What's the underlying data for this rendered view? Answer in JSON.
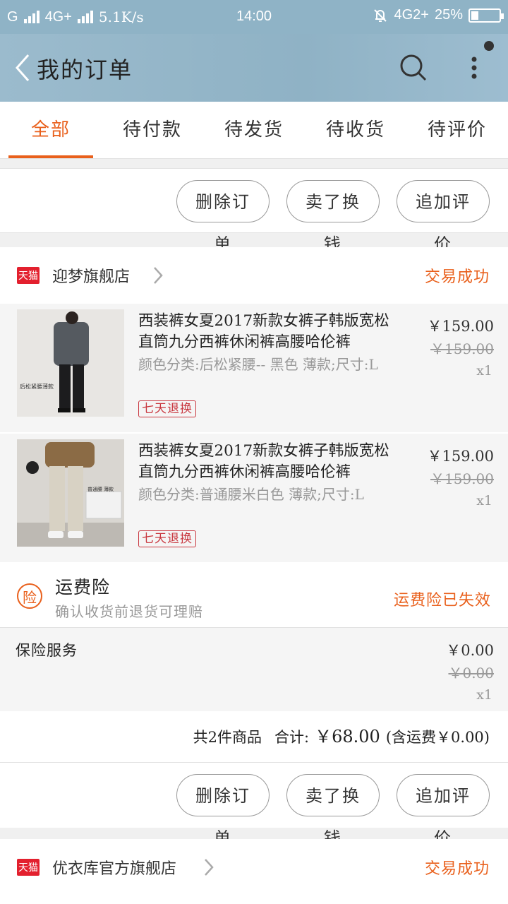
{
  "status_bar": {
    "carrier1": "G",
    "carrier2": "4G+",
    "speed": "5.1K/s",
    "time": "14:00",
    "network": "4G2+",
    "battery": "25%"
  },
  "header": {
    "title": "我的订单",
    "icons": [
      "back-icon",
      "search-icon",
      "more-icon"
    ]
  },
  "tabs": [
    {
      "label": "全部",
      "active": true
    },
    {
      "label": "待付款"
    },
    {
      "label": "待发货"
    },
    {
      "label": "待收货"
    },
    {
      "label": "待评价"
    }
  ],
  "actions": {
    "delete": "删除订单",
    "sell": "卖了换钱",
    "review": "追加评价"
  },
  "orders": [
    {
      "shop_badge": "天猫",
      "shop_name": "迎梦旗舰店",
      "status": "交易成功",
      "items": [
        {
          "name": "西装裤女夏2017新款女裤子韩版宽松直筒九分西裤休闲裤高腰哈伦裤",
          "sku": "颜色分类:后松紧腰-- 黑色  薄款;尺寸:L",
          "badge": "七天退换",
          "price": "￥159.00",
          "original_price": "￥159.00",
          "qty": "x1",
          "thumb_caption": "后松紧腰薄款"
        },
        {
          "name": "西装裤女夏2017新款女裤子韩版宽松直筒九分西裤休闲裤高腰哈伦裤",
          "sku": "颜色分类:普通腰米白色 薄款;尺寸:L",
          "badge": "七天退换",
          "price": "￥159.00",
          "original_price": "￥159.00",
          "qty": "x1",
          "thumb_caption": "普通腰 薄款"
        }
      ],
      "insurance": {
        "icon": "险",
        "title": "运费险",
        "subtitle": "确认收货前退货可理赔",
        "status": "运费险已失效"
      },
      "service": {
        "label": "保险服务",
        "price": "￥0.00",
        "original_price": "￥0.00",
        "qty": "x1"
      },
      "summary": {
        "count": "共2件商品",
        "total_label": "合计:",
        "total": "￥68.00",
        "shipping": "(含运费￥0.00)"
      }
    },
    {
      "shop_badge": "天猫",
      "shop_name": "优衣库官方旗舰店",
      "status": "交易成功"
    }
  ],
  "colors": {
    "accent": "#e9601c",
    "header": "#8fb3c6",
    "tmall": "#e3202e",
    "badge": "#c9373f"
  }
}
